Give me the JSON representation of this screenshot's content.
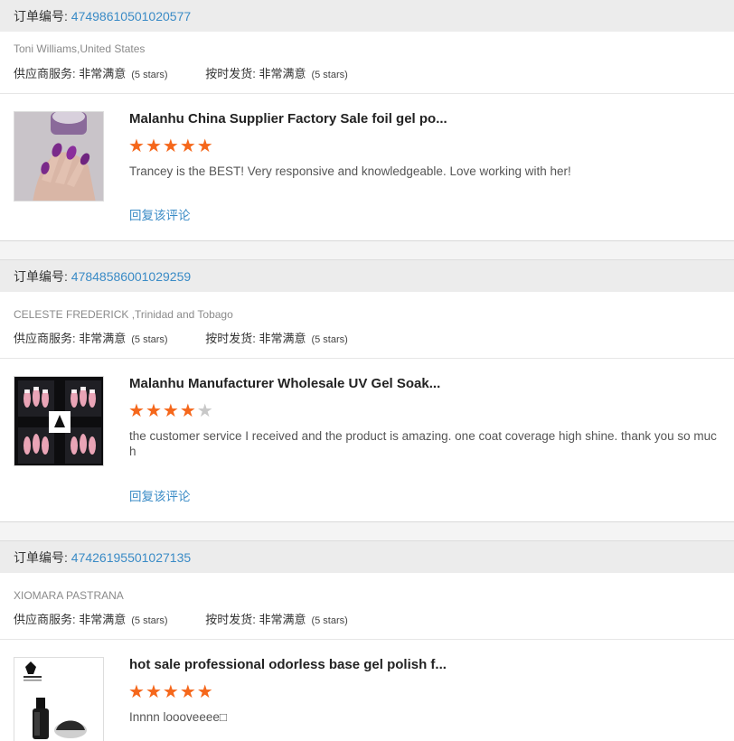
{
  "labels": {
    "order_prefix": "订单编号: ",
    "supplier_service": "供应商服务: ",
    "on_time_delivery": "按时发货: ",
    "reply_link": "回复该评论"
  },
  "colors": {
    "accent": "#3a8bc6",
    "star": "#f5671b",
    "star_empty": "#c8c8c8"
  },
  "reviews": [
    {
      "order_number": "47498610501020577",
      "buyer": "Toni Williams,United States",
      "supplier_rating": "非常满意",
      "supplier_stars": "(5 stars)",
      "delivery_rating": "非常满意",
      "delivery_stars": "(5 stars)",
      "product_title": "Malanhu China Supplier Factory Sale foil gel po...",
      "rating": 5,
      "comment": "Trancey is the BEST! Very responsive and knowledgeable. Love working with her!",
      "thumbnail": "nail-polish-hand-purple"
    },
    {
      "order_number": "47848586001029259",
      "buyer": "CELESTE FREDERICK ,Trinidad and Tobago",
      "supplier_rating": "非常满意",
      "supplier_stars": "(5 stars)",
      "delivery_rating": "非常满意",
      "delivery_stars": "(5 stars)",
      "product_title": "Malanhu Manufacturer Wholesale UV Gel Soak...",
      "rating": 4,
      "comment": "the customer service I received and the product is amazing. one coat coverage high shine. thank you so much",
      "thumbnail": "gel-nails-collage"
    },
    {
      "order_number": "47426195501027135",
      "buyer": "XIOMARA PASTRANA",
      "supplier_rating": "非常满意",
      "supplier_stars": "(5 stars)",
      "delivery_rating": "非常满意",
      "delivery_stars": "(5 stars)",
      "product_title": "hot sale professional odorless base gel polish f...",
      "rating": 5,
      "comment": "Innnn loooveeee□",
      "thumbnail": "malanhu-bottle"
    }
  ]
}
